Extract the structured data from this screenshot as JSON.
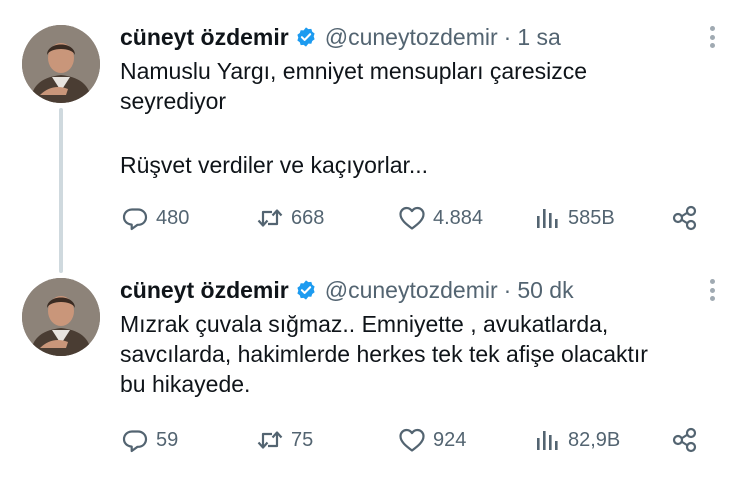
{
  "colors": {
    "text": "#0f1419",
    "secondary": "#536471",
    "verified": "#1d9bf0",
    "thread_line": "#cfd9de"
  },
  "tweets": [
    {
      "author": {
        "name": "cüneyt özdemir",
        "handle": "@cuneytozdemir",
        "verified": true
      },
      "separator": "·",
      "time": "1 sa",
      "text_lines": [
        "Namuslu Yargı, emniyet mensupları çaresizce",
        "seyrediyor"
      ],
      "text_lines2": [
        "Rüşvet verdiler ve kaçıyorlar..."
      ],
      "stats": {
        "replies": "480",
        "retweets": "668",
        "likes": "4.884",
        "views": "585B"
      },
      "icons": {
        "reply": "reply-icon",
        "retweet": "retweet-icon",
        "like": "heart-icon",
        "views": "views-icon",
        "share": "share-icon",
        "more": "more-icon"
      }
    },
    {
      "author": {
        "name": "cüneyt özdemir",
        "handle": "@cuneytozdemir",
        "verified": true
      },
      "separator": "·",
      "time": "50 dk",
      "text_lines": [
        "Mızrak çuvala sığmaz.. Emniyette , avukatlarda,",
        "savcılarda, hakimlerde herkes tek tek afişe olacaktır",
        "bu hikayede."
      ],
      "stats": {
        "replies": "59",
        "retweets": "75",
        "likes": "924",
        "views": "82,9B"
      },
      "icons": {
        "reply": "reply-icon",
        "retweet": "retweet-icon",
        "like": "heart-icon",
        "views": "views-icon",
        "share": "share-icon",
        "more": "more-icon"
      }
    }
  ]
}
